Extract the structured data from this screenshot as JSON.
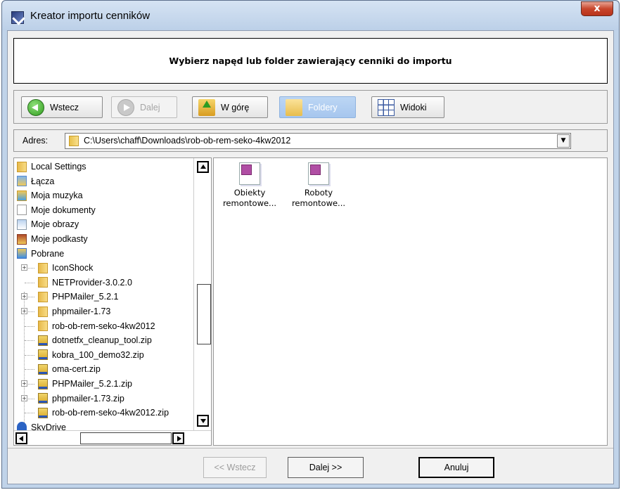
{
  "window": {
    "title": "Kreator importu cenników",
    "close_label": "x"
  },
  "header": {
    "instruction": "Wybierz napęd lub folder zawierający cenniki do importu"
  },
  "toolbar": {
    "back_label": "Wstecz",
    "forward_label": "Dalej",
    "up_label": "W górę",
    "folders_label": "Foldery",
    "views_label": "Widoki"
  },
  "address": {
    "label": "Adres:",
    "value": "C:\\Users\\chaff\\Downloads\\rob-ob-rem-seko-4kw2012"
  },
  "tree": {
    "items": [
      {
        "label": "Local Settings",
        "icon": "folder-icon"
      },
      {
        "label": "Łącza",
        "icon": "links-folder-icon"
      },
      {
        "label": "Moja muzyka",
        "icon": "music-folder-icon"
      },
      {
        "label": "Moje dokumenty",
        "icon": "documents-folder-icon"
      },
      {
        "label": "Moje obrazy",
        "icon": "pictures-folder-icon"
      },
      {
        "label": "Moje podkasty",
        "icon": "podcasts-folder-icon"
      },
      {
        "label": "Pobrane",
        "icon": "downloads-folder-icon"
      },
      {
        "label": "IconShock",
        "icon": "folder-icon"
      },
      {
        "label": "NETProvider-3.0.2.0",
        "icon": "folder-icon"
      },
      {
        "label": "PHPMailer_5.2.1",
        "icon": "folder-icon"
      },
      {
        "label": "phpmailer-1.73",
        "icon": "folder-icon"
      },
      {
        "label": "rob-ob-rem-seko-4kw2012",
        "icon": "folder-icon"
      },
      {
        "label": "dotnetfx_cleanup_tool.zip",
        "icon": "zip-icon"
      },
      {
        "label": "kobra_100_demo32.zip",
        "icon": "zip-icon"
      },
      {
        "label": "oma-cert.zip",
        "icon": "zip-icon"
      },
      {
        "label": "PHPMailer_5.2.1.zip",
        "icon": "zip-icon"
      },
      {
        "label": "phpmailer-1.73.zip",
        "icon": "zip-icon"
      },
      {
        "label": "rob-ob-rem-seko-4kw2012.zip",
        "icon": "zip-icon"
      },
      {
        "label": "SkyDrive",
        "icon": "skydrive-icon"
      }
    ]
  },
  "files": [
    {
      "line1": "Obiekty",
      "line2": "remontowe..."
    },
    {
      "line1": "Roboty",
      "line2": "remontowe..."
    }
  ],
  "footer": {
    "back_label": "<< Wstecz",
    "next_label": "Dalej >>",
    "cancel_label": "Anuluj"
  },
  "colors": {
    "frame": "#c0d3e9",
    "close_button": "#c8462c",
    "pressed_button": "#a6c6ee"
  }
}
